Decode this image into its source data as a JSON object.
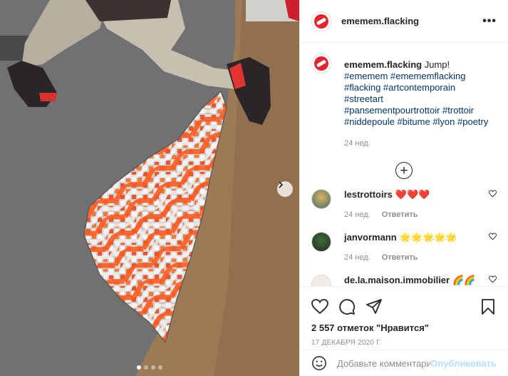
{
  "post": {
    "username": "ememem.flacking",
    "more_label": "•••",
    "caption_text": "Jump!",
    "hashtags_line1": "#ememem #emememflacking",
    "hashtags_line2": "#flacking #artcontemporain #streetart",
    "hashtags_line3": "#pansementpourtrottoir #trottoir",
    "hashtags_line4": "#niddepoule #bitume #lyon #poetry",
    "caption_time": "24 нед.",
    "load_more_label": "+"
  },
  "comments": [
    {
      "username": "lestrottoirs",
      "text": "❤️❤️❤️",
      "time": "24 нед.",
      "reply": "Ответить"
    },
    {
      "username": "janvormann",
      "text": "🌟🌟🌟🌟🌟",
      "time": "24 нед.",
      "reply": "Ответить"
    },
    {
      "username": "de.la.maison.immobilier",
      "text": "🌈🌈",
      "time": "",
      "reply": ""
    }
  ],
  "footer": {
    "likes": "2 557 отметок \"Нравится\"",
    "date": "17 ДЕКАБРЯ 2020 Г.",
    "comment_placeholder": "Добавьте комментарий...",
    "publish_label": "Опубликовать"
  },
  "carousel": {
    "slides": 4,
    "active": 0
  },
  "colors": {
    "brand_red": "#e4232a",
    "link": "#00376b",
    "publish": "#b2dffc"
  },
  "icons": [
    "brand-logo-icon",
    "chevron-right-icon",
    "heart-icon",
    "comment-icon",
    "share-icon",
    "bookmark-icon",
    "smile-icon",
    "plus-circle-icon"
  ]
}
